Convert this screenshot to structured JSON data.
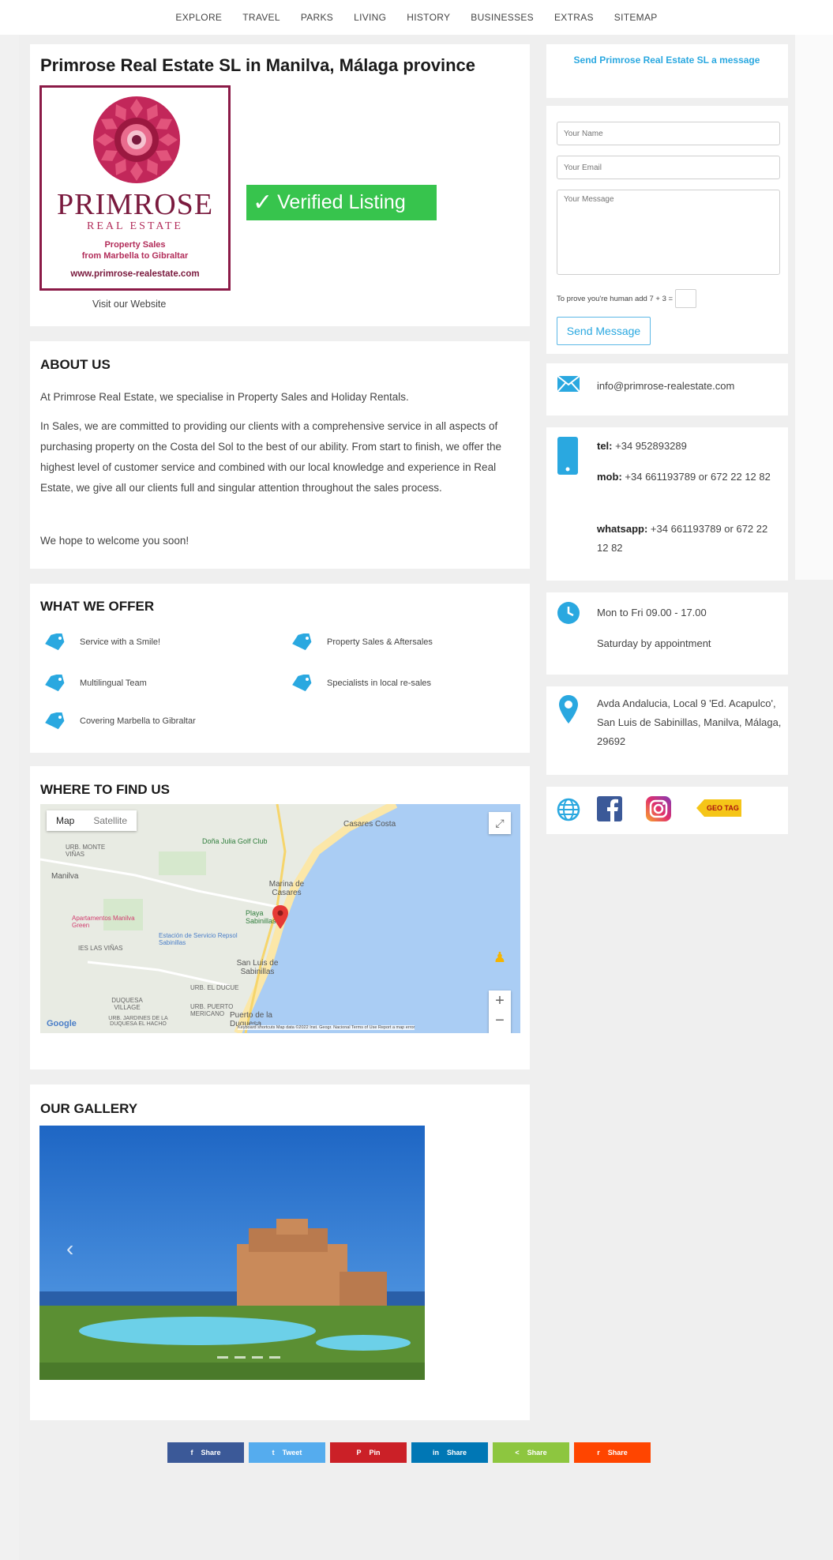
{
  "nav": {
    "items": [
      "EXPLORE",
      "TRAVEL",
      "PARKS",
      "LIVING",
      "HISTORY",
      "BUSINESSES",
      "EXTRAS",
      "SITEMAP"
    ]
  },
  "listing": {
    "title": "Primrose Real Estate SL in Manilva, Málaga province",
    "logo_brand": "PRIMROSE",
    "logo_sub": "REAL ESTATE",
    "logo_line1": "Property Sales",
    "logo_line2": "from Marbella to Gibraltar",
    "logo_url": "www.primrose-realestate.com",
    "verified_label": "Verified Listing",
    "website_label": "Visit our Website"
  },
  "about": {
    "heading": "ABOUT US",
    "p1": "At Primrose Real Estate, we specialise in Property Sales and Holiday Rentals.",
    "p2": "In Sales, we are committed to providing our clients with a comprehensive service in all aspects of purchasing property on the Costa del Sol to the best of our ability. From start to finish, we offer the highest level of customer service and combined with our local knowledge and experience in Real Estate, we give all our clients full and singular attention throughout the sales process.",
    "p3": "We hope to welcome you soon!"
  },
  "offer": {
    "heading": "WHAT WE OFFER",
    "items": [
      "Service with a Smile!",
      "Property Sales & Aftersales",
      "Multilingual Team",
      "Specialists in local re-sales",
      "Covering Marbella to Gibraltar"
    ]
  },
  "find": {
    "heading": "WHERE TO FIND US",
    "map_tab": "Map",
    "satellite_tab": "Satellite",
    "labels": [
      "Casares Costa",
      "Doña Julia Golf Club",
      "URB. MONTE VIÑAS",
      "Manilva",
      "Marina de Casares",
      "Apartamentos Manilva Green",
      "Playa Sabinillas",
      "Estación de Servicio Repsol Sabinillas",
      "IES LAS VIÑAS",
      "San Luis de Sabinillas",
      "URB. EL DUCUE",
      "DUQUESA VILLAGE",
      "URB. PUERTO MERICANO",
      "URB. JARDINES DE LA DUQUESA EL HACHO",
      "Puerto de la Duquesa"
    ],
    "google": "Google",
    "attribution": "Keyboard shortcuts   Map data ©2022 Inst. Geogr. Nacional   Terms of Use   Report a map error",
    "zoom_in": "+",
    "zoom_out": "−"
  },
  "gallery": {
    "heading": "OUR GALLERY",
    "prev": "‹"
  },
  "share": {
    "buttons": [
      {
        "label": "Share",
        "icon": "f",
        "color": "#3b5998"
      },
      {
        "label": "Tweet",
        "icon": "t",
        "color": "#55acee"
      },
      {
        "label": "Pin",
        "icon": "P",
        "color": "#cb2027"
      },
      {
        "label": "Share",
        "icon": "in",
        "color": "#0077b5"
      },
      {
        "label": "Share",
        "icon": "<",
        "color": "#8dc63f"
      },
      {
        "label": "Share",
        "icon": "r",
        "color": "#ff4500"
      }
    ]
  },
  "contact_form": {
    "heading": "Send Primrose Real Estate SL a message",
    "name_placeholder": "Your Name",
    "email_placeholder": "Your Email",
    "message_placeholder": "Your Message",
    "captcha_label": "To prove you're human add 7 + 3 =",
    "submit_label": "Send Message"
  },
  "contact": {
    "email": "info@primrose-realestate.com",
    "tel_label": "tel:",
    "tel": "+34 952893289",
    "mob_label": "mob:",
    "mob": "+34 661193789 or 672 22 12 82",
    "whatsapp_label": "whatsapp:",
    "whatsapp": "+34 661193789 or 672 22 12 82",
    "hours1": "Mon to Fri 09.00 - 17.00",
    "hours2": "Saturday by appointment",
    "address": "Avda Andalucia, Local 9 'Ed. Acapulco', San Luis de Sabinillas, Manilva, Málaga, 29692"
  },
  "social": {
    "geotag_label": "GEO TAG"
  },
  "colors": {
    "accent": "#2aa8e0",
    "verified": "#37c44d",
    "brand": "#7a1a3e"
  }
}
